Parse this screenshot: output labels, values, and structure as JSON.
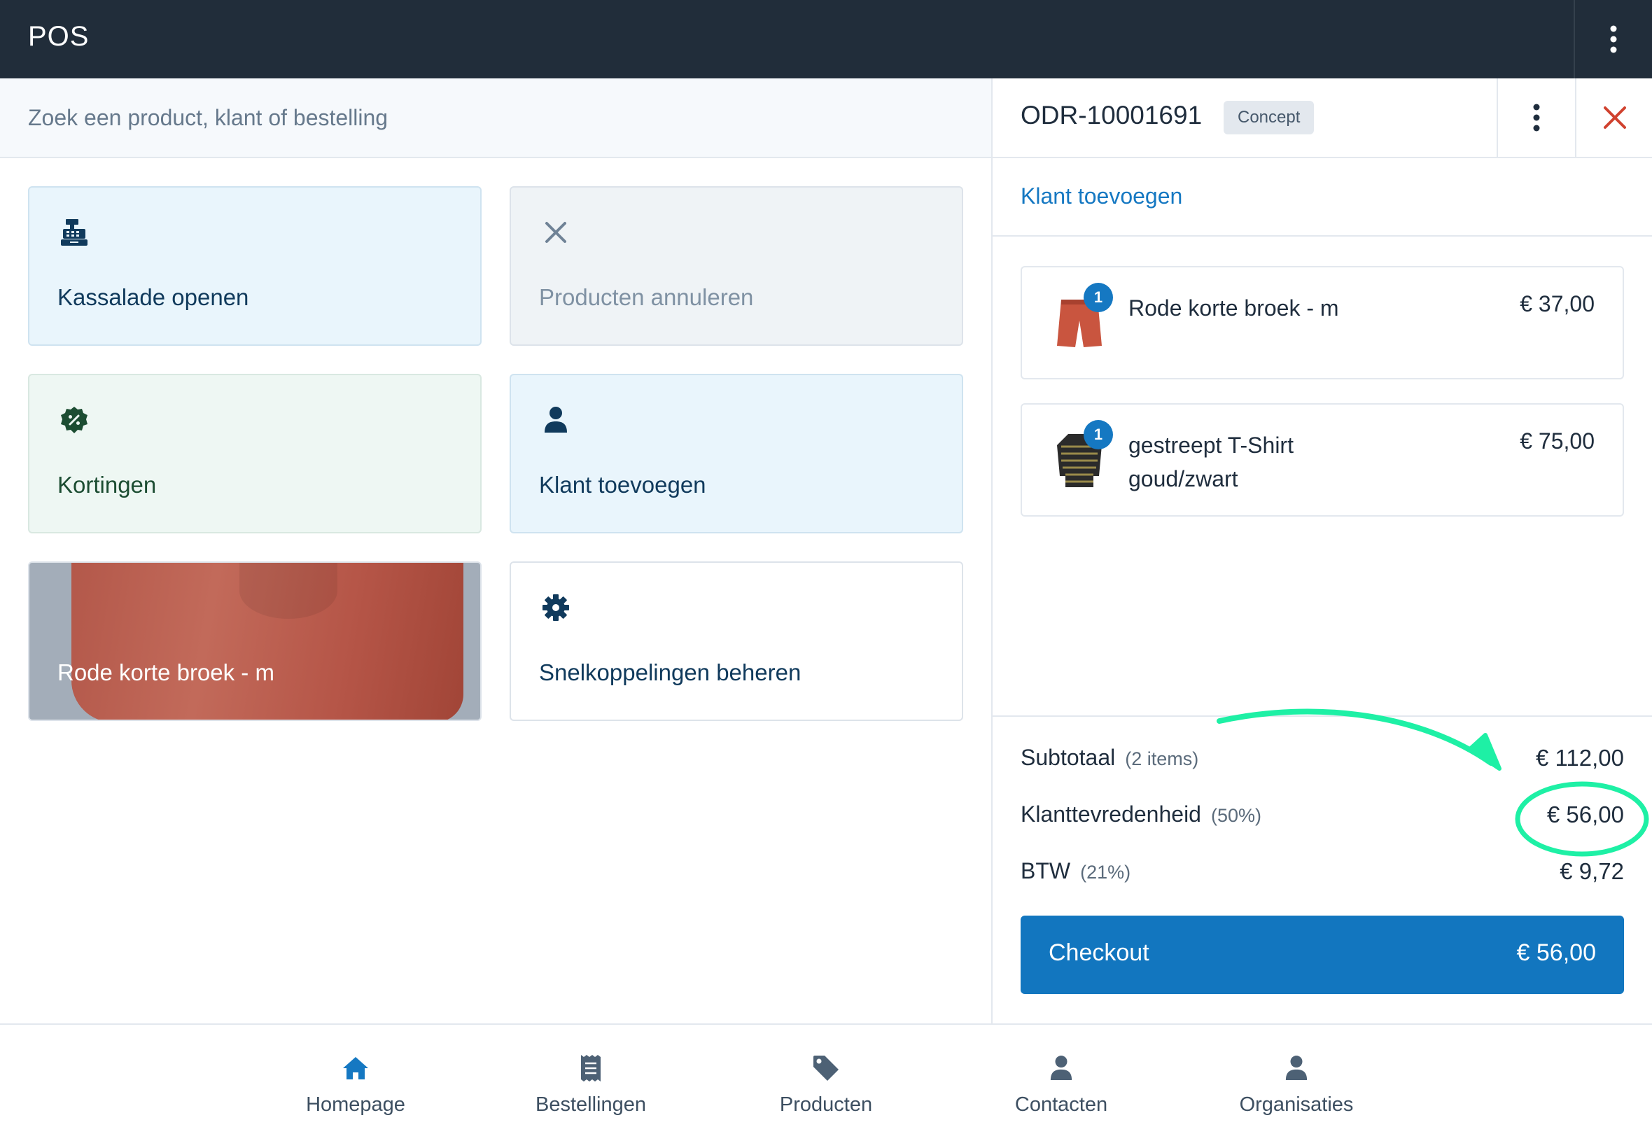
{
  "topbar": {
    "title": "POS"
  },
  "search": {
    "placeholder": "Zoek een product, klant of bestelling"
  },
  "shortcuts": {
    "open_drawer": "Kassalade openen",
    "cancel_products": "Producten annuleren",
    "discounts": "Kortingen",
    "add_customer": "Klant toevoegen",
    "product_red_shorts": "Rode korte broek - m",
    "manage_shortcuts": "Snelkoppelingen beheren"
  },
  "order": {
    "id": "ODR-10001691",
    "status": "Concept",
    "add_customer_link": "Klant toevoegen",
    "items": [
      {
        "name": "Rode korte broek - m",
        "price": "€ 37,00",
        "quantity": "1"
      },
      {
        "name": "gestreept T-Shirt goud/zwart",
        "price": "€ 75,00",
        "quantity": "1"
      }
    ],
    "totals": {
      "subtotal_label": "Subtotaal",
      "subtotal_count": "(2 items)",
      "subtotal_value": "€ 112,00",
      "discount_label": "Klanttevredenheid",
      "discount_pct": "(50%)",
      "discount_value": "€ 56,00",
      "tax_label": "BTW",
      "tax_pct": "(21%)",
      "tax_value": "€ 9,72"
    },
    "checkout": {
      "label": "Checkout",
      "amount": "€ 56,00"
    }
  },
  "nav": {
    "items": [
      {
        "label": "Homepage",
        "icon": "home-icon"
      },
      {
        "label": "Bestellingen",
        "icon": "receipt-icon"
      },
      {
        "label": "Producten",
        "icon": "tag-icon"
      },
      {
        "label": "Contacten",
        "icon": "user-icon"
      },
      {
        "label": "Organisaties",
        "icon": "user-icon"
      }
    ]
  },
  "colors": {
    "topbar": "#212d3a",
    "primary": "#1276bf",
    "close": "#d0412e",
    "annotation": "#1ef0a5"
  }
}
